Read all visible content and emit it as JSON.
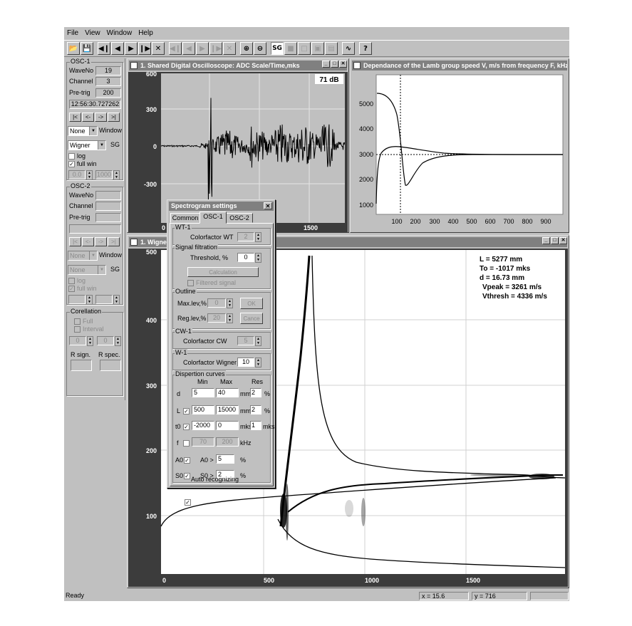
{
  "menu": [
    "File",
    "View",
    "Window",
    "Help"
  ],
  "toolbar_icons": [
    "open-icon",
    "save-icon",
    "first-icon",
    "prev-icon",
    "next-icon",
    "last-icon",
    "cut-icon",
    "first-dis-icon",
    "prev-dis-icon",
    "next-dis-icon",
    "last-dis-icon",
    "cut-dis-icon",
    "zoom-in-icon",
    "zoom-out-icon",
    "sg-icon",
    "tile-icon",
    "cascade-icon",
    "window-icon",
    "window2-icon",
    "wave-icon",
    "help-icon"
  ],
  "toolbar": {
    "sg_label": "SG",
    "help_label": "?"
  },
  "osc1": {
    "title": "OSC-1",
    "waveno_label": "WaveNo",
    "waveno": "19",
    "channel_label": "Channel",
    "channel": "3",
    "pretrig_label": "Pre-trig",
    "pretrig": "200",
    "time": "12:56:30.727262",
    "nav": [
      "|<",
      "<-",
      "->",
      ">|"
    ],
    "window_sel": "None",
    "window_label": "Window",
    "sg_sel": "Wigner",
    "sg_label": "SG",
    "log_label": "log",
    "fullwin_label": "full win",
    "val1": "0.0",
    "val2": "1000"
  },
  "osc2": {
    "title": "OSC-2",
    "waveno_label": "WaveNo",
    "channel_label": "Channel",
    "pretrig_label": "Pre-trig",
    "nav": [
      "|<",
      "<-",
      "->",
      ">|"
    ],
    "window_sel": "None",
    "window_label": "Window",
    "sg_sel": "None",
    "sg_label": "SG",
    "log_label": "log",
    "fullwin_label": "full win"
  },
  "corr": {
    "title": "Corellation",
    "full_label": "Full",
    "interval_label": "Interval",
    "v1": "0",
    "v2": "0",
    "rsign_label": "R sign.",
    "rspec_label": "R spec."
  },
  "osc_win": {
    "title": "1. Shared Digital Oscilloscope:  ADC Scale/Time,mks",
    "db": "71 dB",
    "y_ticks": [
      "600",
      "300",
      "0",
      "-300"
    ],
    "x_ticks": [
      "0",
      "500",
      "1000",
      "1500"
    ]
  },
  "lamb_win": {
    "title": "Dependance of the Lamb group speed V, m/s from frequency F, kHz",
    "y_ticks": [
      "5000",
      "4000",
      "3000",
      "2000",
      "1000"
    ],
    "x_ticks": [
      "100",
      "200",
      "300",
      "400",
      "500",
      "600",
      "700",
      "800",
      "900"
    ]
  },
  "wig_win": {
    "title": "1. Wigner",
    "y_ticks": [
      "500",
      "400",
      "300",
      "200",
      "100"
    ],
    "x_ticks": [
      "0",
      "500",
      "1000",
      "1500"
    ],
    "info": [
      "L = 5277 mm",
      "To = -1017 mks",
      "d = 16.73 mm",
      "Vpeak = 3261 m/s",
      "Vthresh = 4336 m/s"
    ]
  },
  "dialog": {
    "title": "Spectrogram settings",
    "tabs": [
      "Common",
      "OSC-1",
      "OSC-2"
    ],
    "wt_group": "WT-1",
    "colorfactor_wt_label": "Colorfactor WT",
    "colorfactor_wt": "2",
    "signal_group": "Signal filtration",
    "threshold_label": "Threshold, %",
    "threshold": "0",
    "calc_btn": "Calculation",
    "filtered_label": "Filtered signal",
    "outline_group": "Outline",
    "maxlev_label": "Max.lev,%",
    "maxlev": "0",
    "reglev_label": "Reg.lev,%",
    "reglev": "20",
    "ok_btn": "OK",
    "cancel_btn": "Cance",
    "cw_group": "CW-1",
    "colorfactor_cw_label": "Colorfactor CW",
    "colorfactor_cw": "5",
    "w_group": "W-1",
    "colorfactor_w_label": "Colorfactor Wigner",
    "colorfactor_w": "10",
    "disp_group": "Dispertion curves",
    "col_min": "Min",
    "col_max": "Max",
    "col_res": "Res",
    "rows": [
      {
        "label": "d",
        "min": "5",
        "max": "40",
        "unit": "mm",
        "res": "2",
        "res_unit": "%"
      },
      {
        "label": "L",
        "min": "500",
        "max": "15000",
        "unit": "mm",
        "res": "2",
        "res_unit": "%"
      },
      {
        "label": "t0",
        "min": "-2000",
        "max": "0",
        "unit": "mks",
        "res": "1",
        "res_unit": "mks"
      },
      {
        "label": "f",
        "min": "70",
        "max": "200",
        "unit": "kHz",
        "res": "",
        "res_unit": ""
      }
    ],
    "a0_label": "A0",
    "a0_cmp": "A0 >",
    "a0_val": "5",
    "a0_unit": "%",
    "s0_label": "S0",
    "s0_cmp": "S0 >",
    "s0_val": "2",
    "s0_unit": "%",
    "auto_label": "Auto recognizing"
  },
  "status": {
    "ready": "Ready",
    "x": "x = 15.6",
    "y": "y = 716"
  }
}
